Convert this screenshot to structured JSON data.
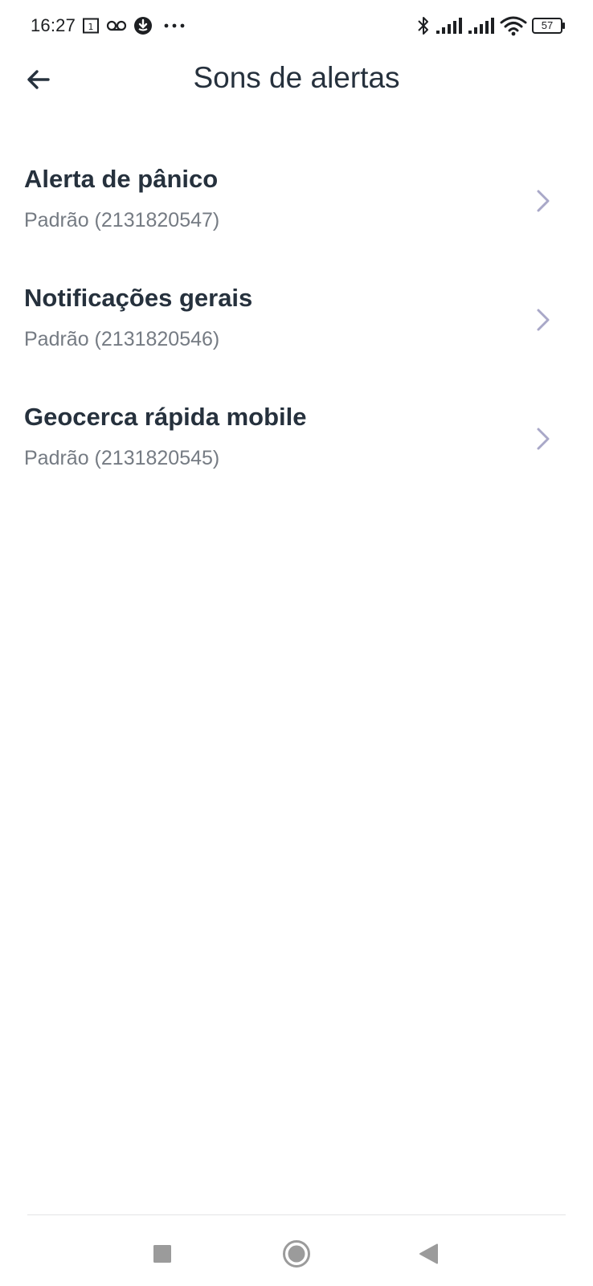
{
  "status_bar": {
    "time": "16:27",
    "battery_level": "57",
    "left_icons": [
      "calendar-icon",
      "voicemail-icon",
      "app-notification-icon",
      "more-dots-icon"
    ],
    "right_icons": [
      "bluetooth-icon",
      "signal-icon",
      "signal-icon",
      "wifi-icon",
      "battery-icon"
    ]
  },
  "header": {
    "title": "Sons de alertas",
    "back_icon": "arrow-left-icon"
  },
  "list": {
    "items": [
      {
        "title": "Alerta de pânico",
        "subtitle": "Padrão (2131820547)",
        "icon": "chevron-right-icon"
      },
      {
        "title": "Notificações gerais",
        "subtitle": "Padrão (2131820546)",
        "icon": "chevron-right-icon"
      },
      {
        "title": "Geocerca rápida mobile",
        "subtitle": "Padrão (2131820545)",
        "icon": "chevron-right-icon"
      }
    ]
  },
  "nav_bar": {
    "buttons": [
      "recents-icon",
      "home-icon",
      "back-triangle-icon"
    ]
  },
  "colors": {
    "title_text": "#26313d",
    "subtitle_text": "#757b83",
    "chevron": "#a9a8c8",
    "nav_icons": "#9b9b9b",
    "background": "#ffffff"
  }
}
